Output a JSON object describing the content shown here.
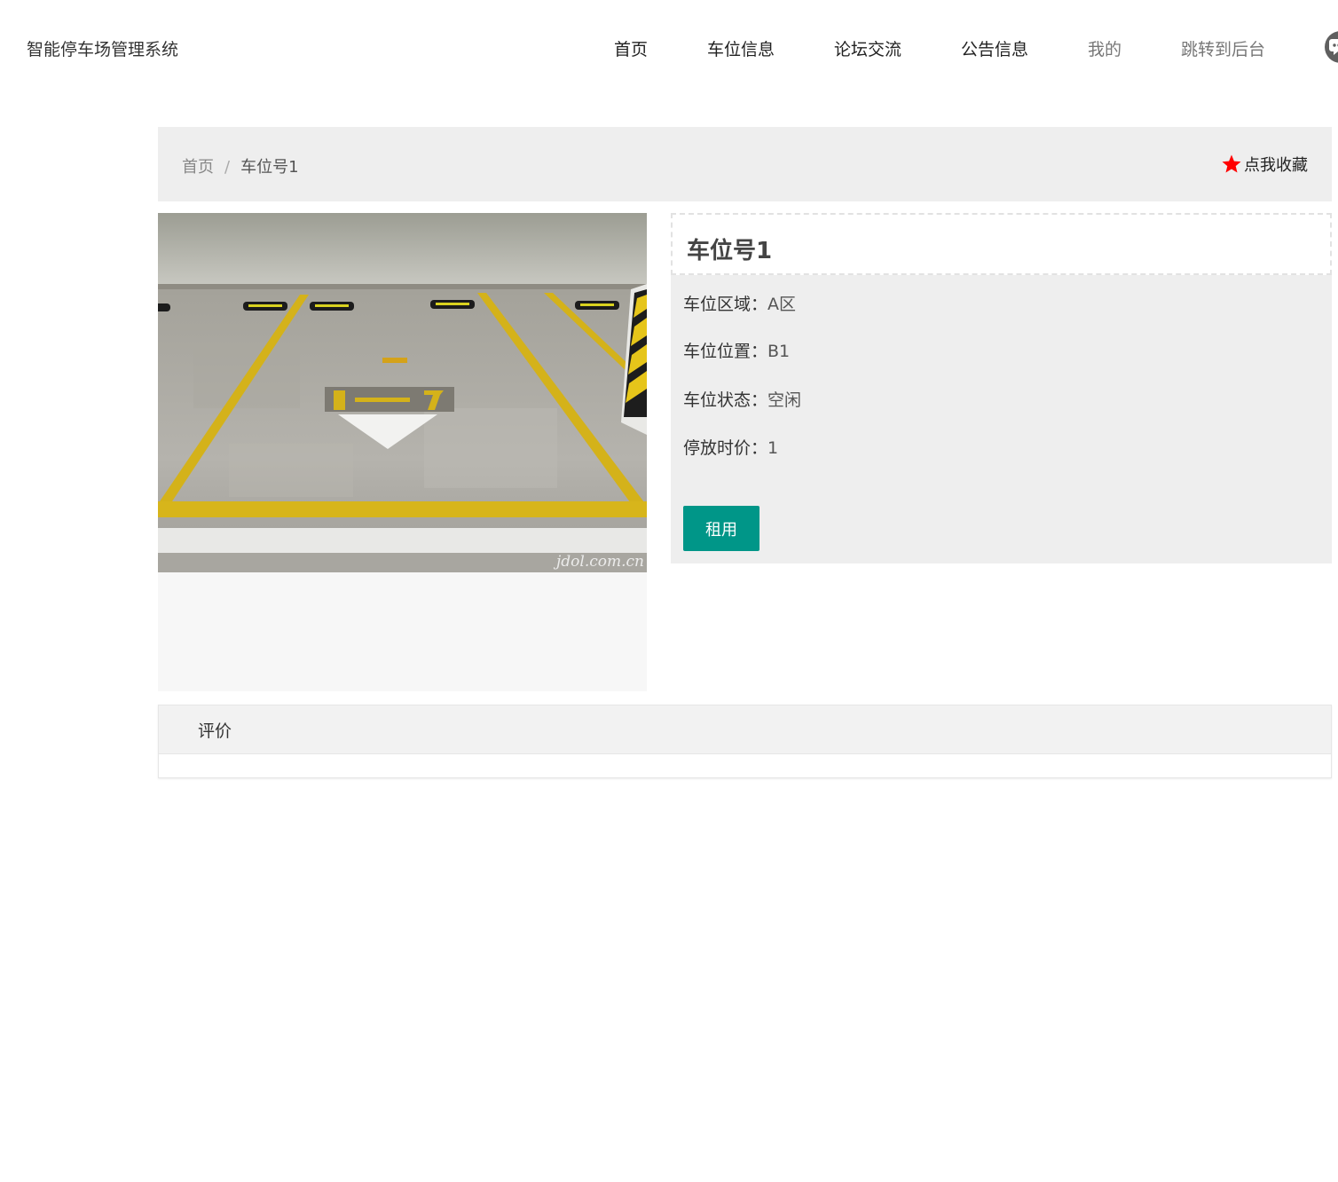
{
  "header": {
    "brand": "智能停车场管理系统",
    "nav": [
      {
        "label": "首页"
      },
      {
        "label": "车位信息"
      },
      {
        "label": "论坛交流"
      },
      {
        "label": "公告信息"
      },
      {
        "label": "我的"
      },
      {
        "label": "跳转到后台"
      }
    ]
  },
  "breadcrumb": {
    "home": "首页",
    "separator": "/",
    "current": "车位号1"
  },
  "favorite": {
    "label": "点我收藏",
    "icon": "star-icon",
    "color": "#ff0000"
  },
  "photo": {
    "watermark": "jdol.com.cn",
    "bay_number": "1—7"
  },
  "detail": {
    "title": "车位号1",
    "fields": [
      {
        "key": "车位区域：",
        "value": "A区"
      },
      {
        "key": "车位位置：",
        "value": "B1"
      },
      {
        "key": "车位状态：",
        "value": "空闲"
      },
      {
        "key": "停放时价：",
        "value": "1"
      }
    ],
    "rent_button": "租用",
    "accent": "#009688"
  },
  "review": {
    "title": "评价"
  }
}
